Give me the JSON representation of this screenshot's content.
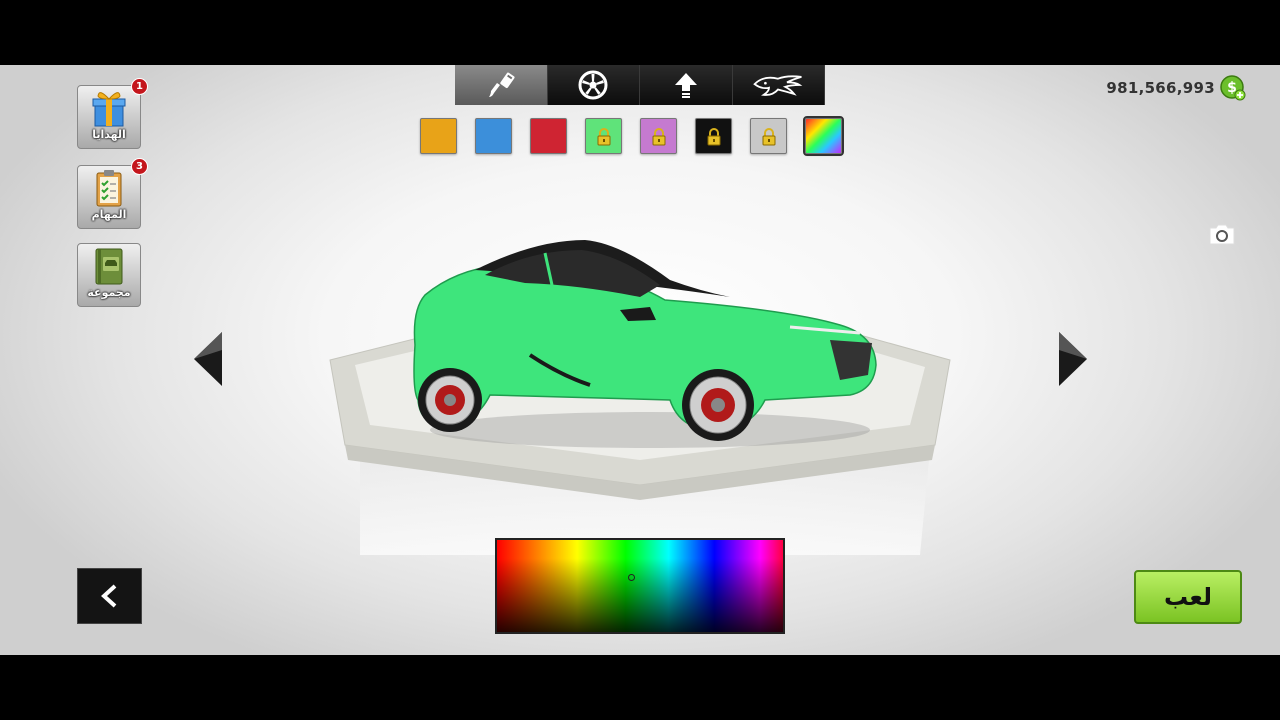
{
  "hud": {
    "money": "981,566,993",
    "money_icon": "cash-coin-plus-icon"
  },
  "tabs": [
    {
      "name": "paint",
      "icon": "paint-brush-icon",
      "active": true
    },
    {
      "name": "wheels",
      "icon": "wheel-icon",
      "active": false
    },
    {
      "name": "upgrade",
      "icon": "upgrade-arrow-icon",
      "active": false
    },
    {
      "name": "decals",
      "icon": "tribal-dragon-decal-icon",
      "active": false
    }
  ],
  "swatches": [
    {
      "color": "#e8a318",
      "locked": false
    },
    {
      "color": "#3c8fda",
      "locked": false
    },
    {
      "color": "#cf2432",
      "locked": false
    },
    {
      "color": "#5fe37a",
      "locked": true
    },
    {
      "color": "#c57ad0",
      "locked": true
    },
    {
      "color": "#111111",
      "locked": true
    },
    {
      "color": "#c8c8c8",
      "locked": true
    },
    {
      "color": "rainbow",
      "locked": false,
      "selected": true
    }
  ],
  "side_menu": {
    "gifts": {
      "label": "الهدايا",
      "badge": "1"
    },
    "missions": {
      "label": "المهام",
      "badge": "3"
    },
    "collection": {
      "label": "مجموعة"
    }
  },
  "actions": {
    "play_label": "لعب"
  },
  "car": {
    "body_color": "#3ee57c"
  },
  "colors": {
    "play_green": "#8fd33a",
    "badge_red": "#c4161c"
  }
}
